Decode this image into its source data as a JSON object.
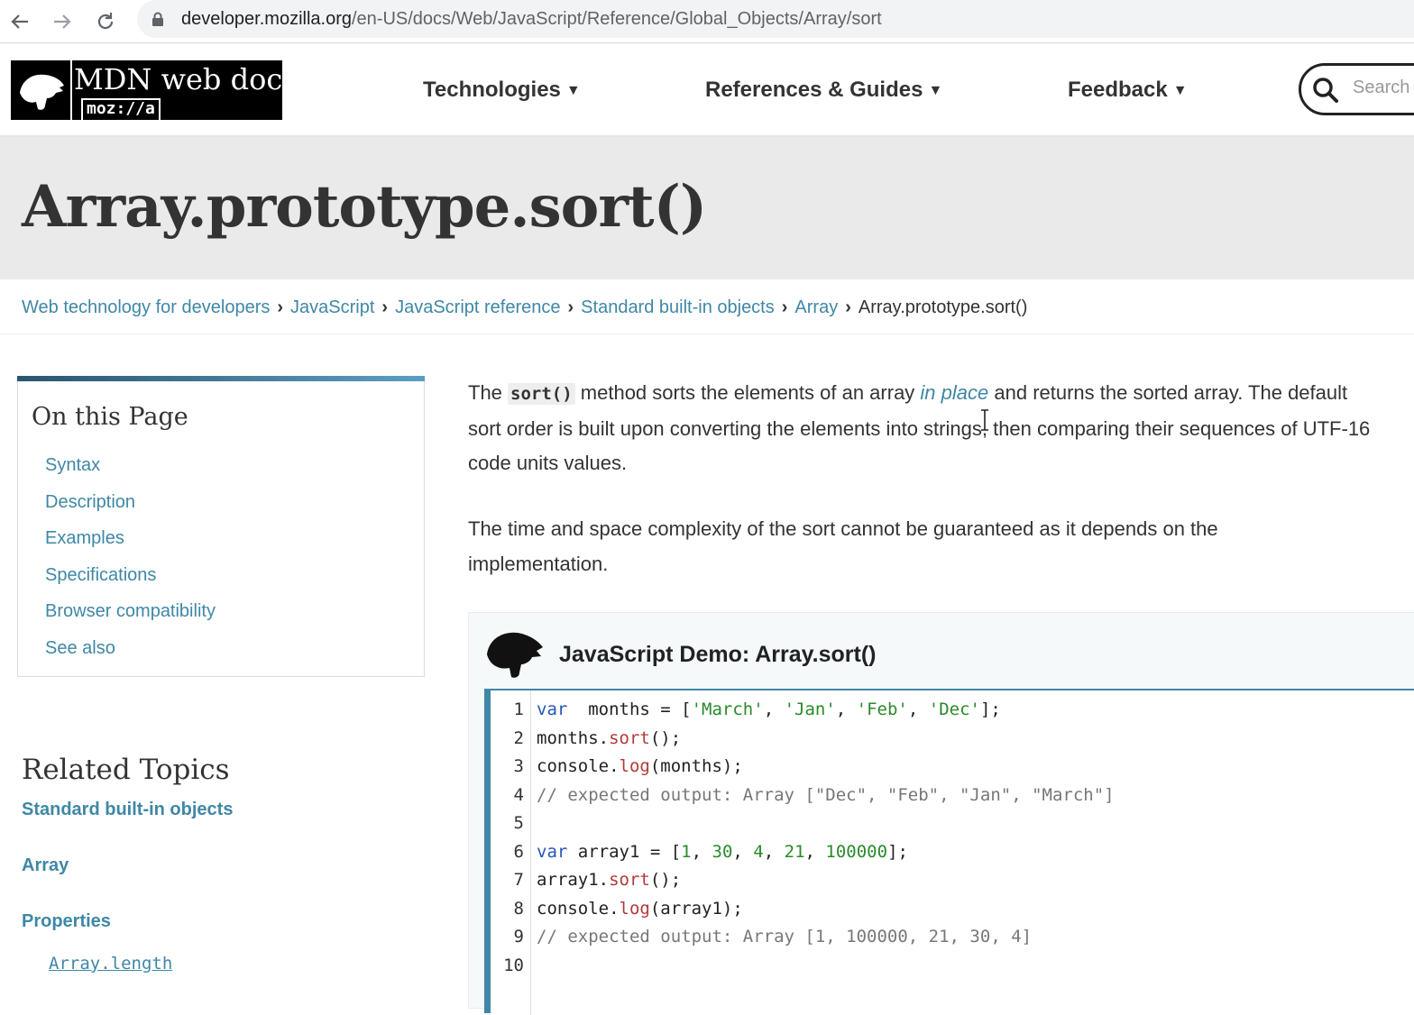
{
  "browser": {
    "url_host": "developer.mozilla.org",
    "url_path": "/en-US/docs/Web/JavaScript/Reference/Global_Objects/Array/sort"
  },
  "header": {
    "logo_text": "MDN web docs",
    "logo_sub": "moz://a",
    "nav": [
      "Technologies",
      "References & Guides",
      "Feedback"
    ],
    "search_placeholder": "Search"
  },
  "page": {
    "title": "Array.prototype.sort()"
  },
  "breadcrumb": {
    "items": [
      "Web technology for developers",
      "JavaScript",
      "JavaScript reference",
      "Standard built-in objects",
      "Array"
    ],
    "current": "Array.prototype.sort()"
  },
  "toc": {
    "heading": "On this Page",
    "items": [
      "Syntax",
      "Description",
      "Examples",
      "Specifications",
      "Browser compatibility",
      "See also"
    ]
  },
  "related": {
    "heading": "Related Topics",
    "link1": "Standard built-in objects",
    "link2": "Array",
    "link3": "Properties",
    "prop1": "Array.length"
  },
  "content": {
    "p1_before": "The ",
    "p1_code": "sort()",
    "p1_mid": " method sorts the elements of an array ",
    "p1_link": "in place",
    "p1_after": " and returns the sorted array. The default sort order is built upon converting the elements into strings, then comparing their sequences of UTF-16 code units values.",
    "p2": "The time and space complexity of the sort cannot be guaranteed as it depends on the implementation."
  },
  "demo": {
    "title": "JavaScript Demo: Array.sort()",
    "lines": [
      {
        "n": "1",
        "tokens": [
          [
            "kw",
            "var"
          ],
          [
            "",
            "  months = ["
          ],
          [
            "str",
            "'March'"
          ],
          [
            "",
            ", "
          ],
          [
            "str",
            "'Jan'"
          ],
          [
            "",
            ", "
          ],
          [
            "str",
            "'Feb'"
          ],
          [
            "",
            ", "
          ],
          [
            "str",
            "'Dec'"
          ],
          [
            "",
            "];"
          ]
        ]
      },
      {
        "n": "2",
        "tokens": [
          [
            "",
            "months."
          ],
          [
            "fn",
            "sort"
          ],
          [
            "",
            "();"
          ]
        ]
      },
      {
        "n": "3",
        "tokens": [
          [
            "",
            "console."
          ],
          [
            "fn",
            "log"
          ],
          [
            "",
            "(months);"
          ]
        ]
      },
      {
        "n": "4",
        "tokens": [
          [
            "cmt",
            "// expected output: Array [\"Dec\", \"Feb\", \"Jan\", \"March\"]"
          ]
        ]
      },
      {
        "n": "5",
        "tokens": []
      },
      {
        "n": "6",
        "tokens": [
          [
            "kw",
            "var"
          ],
          [
            "",
            " array1 = ["
          ],
          [
            "num",
            "1"
          ],
          [
            "",
            ", "
          ],
          [
            "num",
            "30"
          ],
          [
            "",
            ", "
          ],
          [
            "num",
            "4"
          ],
          [
            "",
            ", "
          ],
          [
            "num",
            "21"
          ],
          [
            "",
            ", "
          ],
          [
            "num",
            "100000"
          ],
          [
            "",
            "];"
          ]
        ]
      },
      {
        "n": "7",
        "tokens": [
          [
            "",
            "array1."
          ],
          [
            "fn",
            "sort"
          ],
          [
            "",
            "();"
          ]
        ]
      },
      {
        "n": "8",
        "tokens": [
          [
            "",
            "console."
          ],
          [
            "fn",
            "log"
          ],
          [
            "",
            "(array1);"
          ]
        ]
      },
      {
        "n": "9",
        "tokens": [
          [
            "cmt",
            "// expected output: Array [1, 100000, 21, 30, 4]"
          ]
        ]
      },
      {
        "n": "10",
        "tokens": []
      }
    ]
  }
}
